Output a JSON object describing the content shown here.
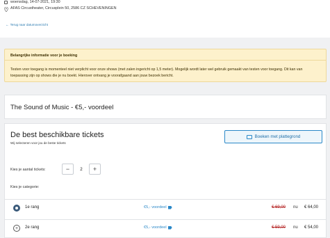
{
  "event": {
    "date_line": "woensdag, 14-07-2021, 19:30",
    "venue_line": "AFAS Circustheater, Circusplein 50, 2586 CZ SCHEVENINGEN",
    "back_link": "Terug naar datumoverzicht"
  },
  "info": {
    "heading": "Belangrijke informatie voor je boeking",
    "text": "Testen voor toegang is momenteel niet verplicht voor onze shows (met zalen ingericht op 1,5 meter). Mogelijk wordt later wel gebruik gemaakt van testen voor toegang. Dit kan van toepassing zijn op shows die je nu boekt. Hierover ontvang je voorafgaand aan jouw bezoek bericht."
  },
  "show": {
    "title": "The Sound of Music - €5,- voordeel"
  },
  "tickets": {
    "heading": "De best beschikbare tickets",
    "subheading": "Wij selecteren voor jou de beste tickets",
    "plan_button": "Boeken met plattegrond",
    "qty_label": "Kies je aantal tickets:",
    "qty_value": "2",
    "minus": "−",
    "plus": "+",
    "category_label": "Kies je categorie:",
    "rows": [
      {
        "name": "1e rang",
        "discount": "€5,- voordeel",
        "old_price": "€ 69,00",
        "nu": "nu",
        "new_price": "€ 64,00",
        "selected": true
      },
      {
        "name": "2e rang",
        "discount": "€5,- voordeel",
        "old_price": "€ 59,00",
        "nu": "nu",
        "new_price": "€ 54,00",
        "selected": false
      }
    ]
  },
  "colors": {
    "accent": "#2a88c8",
    "warning_bg": "#fdf1cc",
    "strike_price": "#b32020"
  }
}
